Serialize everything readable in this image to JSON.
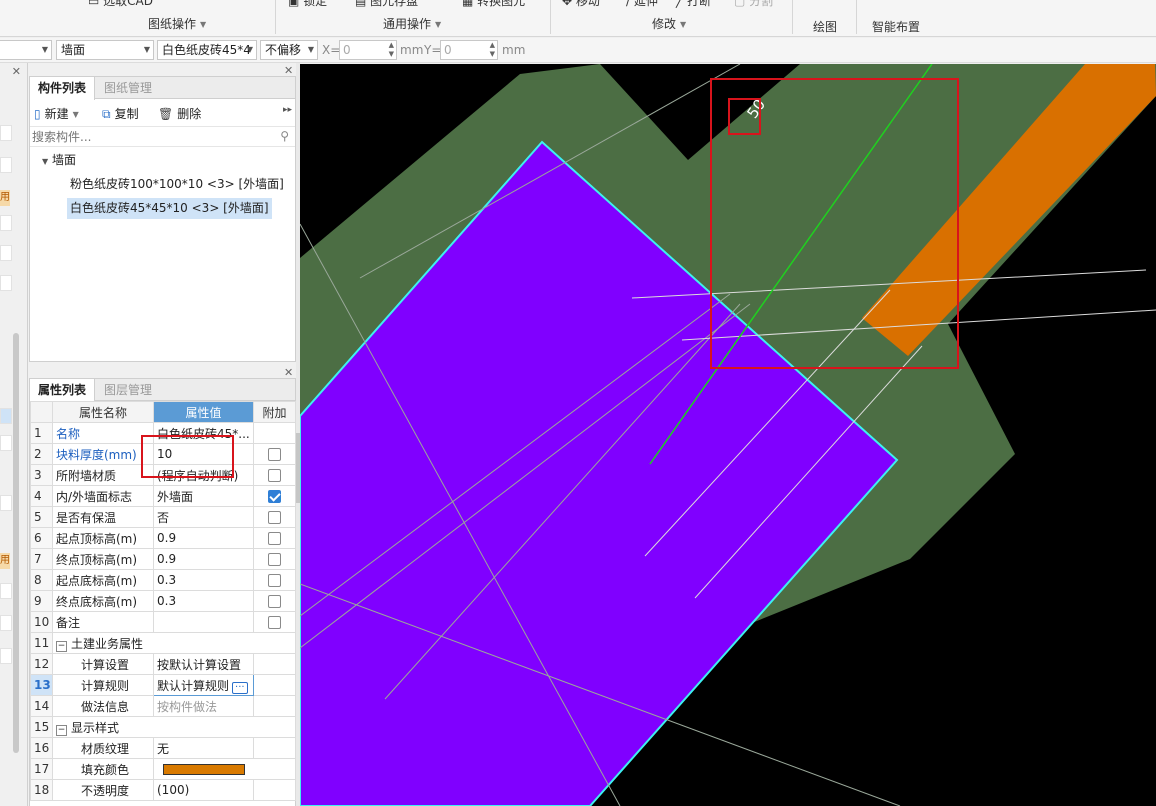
{
  "ribbon": {
    "cad_button": "选取CAD",
    "lock_button": "锁定",
    "save_button": "图元存盘",
    "convert_button": "转换图元",
    "move_button": "移动",
    "extend_button": "延伸",
    "break_button": "打断",
    "split_button": "分割",
    "groups": [
      "图纸操作",
      "通用操作",
      "修改",
      "绘图",
      "智能布置"
    ]
  },
  "options_bar": {
    "category": "墙面",
    "component": "白色纸皮砖45*4",
    "offset_mode": "不偏移",
    "x_label": "X=",
    "x_value": "0",
    "x_unit": "mm",
    "y_label": "Y=",
    "y_value": "0",
    "y_unit": "mm"
  },
  "left_strip": {
    "badge": "用"
  },
  "component_panel": {
    "tabs": [
      "构件列表",
      "图纸管理"
    ],
    "new_button": "新建",
    "copy_button": "复制",
    "delete_button": "删除",
    "search_placeholder": "搜索构件...",
    "tree_root": "墙面",
    "items": [
      "粉色纸皮砖100*100*10 <3> [外墙面]",
      "白色纸皮砖45*45*10 <3> [外墙面]"
    ]
  },
  "property_panel": {
    "tabs": [
      "属性列表",
      "图层管理"
    ],
    "headers": [
      "属性名称",
      "属性值",
      "附加"
    ],
    "rows": [
      {
        "n": "1",
        "name": "名称",
        "value": "白色纸皮砖45*..."
      },
      {
        "n": "2",
        "name": "块料厚度(mm)",
        "value": "10"
      },
      {
        "n": "3",
        "name": "所附墙材质",
        "value": "(程序自动判断)"
      },
      {
        "n": "4",
        "name": "内/外墙面标志",
        "value": "外墙面"
      },
      {
        "n": "5",
        "name": "是否有保温",
        "value": "否"
      },
      {
        "n": "6",
        "name": "起点顶标高(m)",
        "value": "0.9"
      },
      {
        "n": "7",
        "name": "终点顶标高(m)",
        "value": "0.9"
      },
      {
        "n": "8",
        "name": "起点底标高(m)",
        "value": "0.3"
      },
      {
        "n": "9",
        "name": "终点底标高(m)",
        "value": "0.3"
      },
      {
        "n": "10",
        "name": "备注",
        "value": ""
      },
      {
        "n": "11",
        "name": "土建业务属性",
        "value": ""
      },
      {
        "n": "12",
        "name": "计算设置",
        "value": "按默认计算设置"
      },
      {
        "n": "13",
        "name": "计算规则",
        "value": "默认计算规则"
      },
      {
        "n": "14",
        "name": "做法信息",
        "value": "按构件做法"
      },
      {
        "n": "15",
        "name": "显示样式",
        "value": ""
      },
      {
        "n": "16",
        "name": "材质纹理",
        "value": "无"
      },
      {
        "n": "17",
        "name": "填充颜色",
        "value": ""
      },
      {
        "n": "18",
        "name": "不透明度",
        "value": "(100)"
      }
    ]
  },
  "canvas": {
    "dimension_label": "50",
    "fill_color": "#d97a00"
  }
}
